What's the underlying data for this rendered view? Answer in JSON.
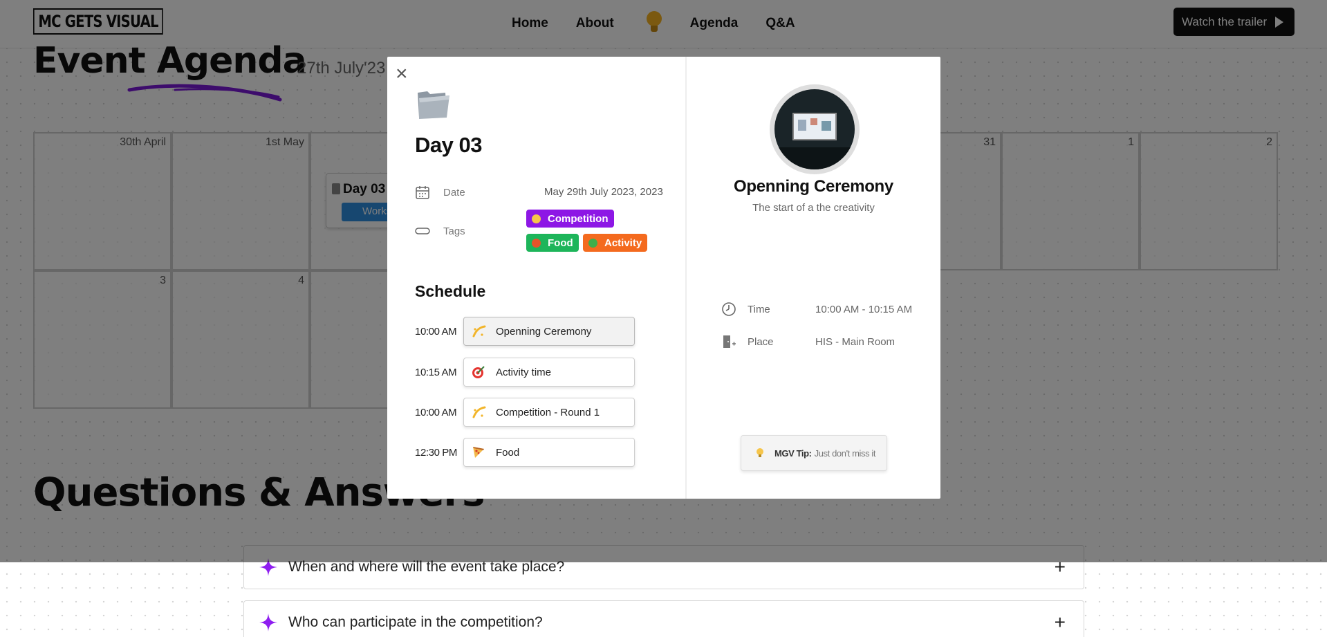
{
  "nav": {
    "logo": "MC GETS VISUAL",
    "links": [
      "Home",
      "About",
      "Agenda",
      "Q&A"
    ],
    "cta": "Watch the trailer"
  },
  "agenda": {
    "title": "Event Agenda",
    "date": "27th July'23",
    "calendar_row1": [
      "30th April",
      "1st May",
      "",
      "",
      "",
      "",
      "31",
      "1",
      "2"
    ],
    "calendar_row2": [
      "3",
      "4",
      ""
    ],
    "event_card": {
      "title": "Day 03",
      "tag": "Workshop"
    }
  },
  "qa": {
    "title": "Questions & Answers",
    "items": [
      "When and where will the event take place?",
      "Who can participate in the competition?"
    ]
  },
  "modal": {
    "day_title": "Day 03",
    "date_label": "Date",
    "date_value": "May 29th July 2023, 2023",
    "tags_label": "Tags",
    "tags": [
      {
        "label": "Competition",
        "color": "#8d17e5"
      },
      {
        "label": "Food",
        "color": "#1db55a"
      },
      {
        "label": "Activity",
        "color": "#f46a1e"
      }
    ],
    "schedule_title": "Schedule",
    "schedule": [
      {
        "time": "10:00 AM",
        "label": "Openning Ceremony",
        "icon": "sparkle-icon"
      },
      {
        "time": "10:15 AM",
        "label": "Activity time",
        "icon": "target-icon"
      },
      {
        "time": "10:00 AM",
        "label": "Competition - Round 1",
        "icon": "sparkle-icon"
      },
      {
        "time": "12:30 PM",
        "label": "Food",
        "icon": "pizza-icon"
      }
    ],
    "detail": {
      "name": "Openning Ceremony",
      "description": "The start of a the creativity",
      "time_label": "Time",
      "time_value": "10:00 AM - 10:15 AM",
      "place_label": "Place",
      "place_value": "HIS - Main Room",
      "tip_label": "MGV Tip:",
      "tip_text": "Just don't miss it"
    }
  }
}
